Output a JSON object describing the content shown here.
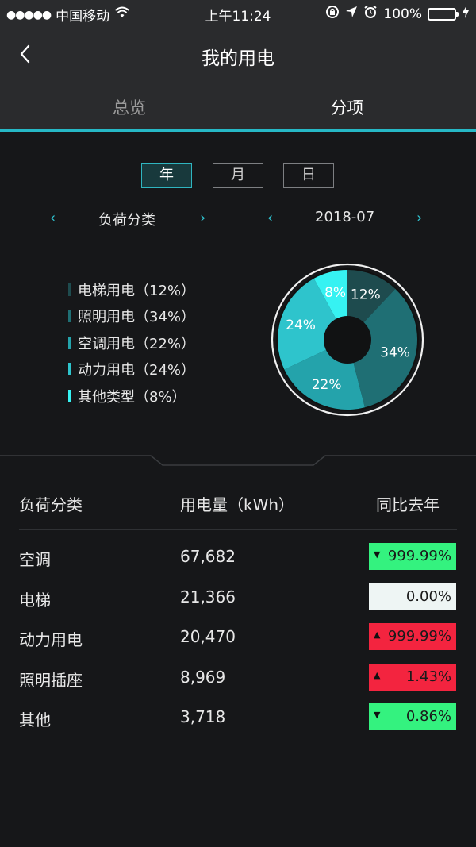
{
  "status": {
    "signal": "●●●●●",
    "carrier": "中国移动",
    "time": "上午11:24",
    "battery": "100%"
  },
  "nav": {
    "title": "我的用电"
  },
  "tabs": [
    {
      "label": "总览",
      "active": false
    },
    {
      "label": "分项",
      "active": true
    }
  ],
  "period": [
    {
      "label": "年",
      "active": true
    },
    {
      "label": "月",
      "active": false
    },
    {
      "label": "日",
      "active": false
    }
  ],
  "selectors": {
    "category": "负荷分类",
    "date": "2018-07",
    "prev": "‹",
    "next": "›"
  },
  "legend": [
    {
      "label": "电梯用电（12%）",
      "color": "#1e4b4e"
    },
    {
      "label": "照明用电（34%）",
      "color": "#1f6f74"
    },
    {
      "label": "空调用电（22%）",
      "color": "#24a3ab"
    },
    {
      "label": "动力用电（24%）",
      "color": "#2ec4cc"
    },
    {
      "label": "其他类型（8%）",
      "color": "#36f2f2"
    }
  ],
  "chart_data": {
    "type": "pie",
    "series": [
      {
        "name": "电梯用电",
        "value": 12,
        "label": "12%",
        "color": "#1e4b4e"
      },
      {
        "name": "照明用电",
        "value": 34,
        "label": "34%",
        "color": "#1f6f74"
      },
      {
        "name": "空调用电",
        "value": 22,
        "label": "22%",
        "color": "#24a3ab"
      },
      {
        "name": "动力用电",
        "value": 24,
        "label": "24%",
        "color": "#2ec4cc"
      },
      {
        "name": "其他类型",
        "value": 8,
        "label": "8%",
        "color": "#36f2f2"
      }
    ]
  },
  "table": {
    "headers": [
      "负荷分类",
      "用电量（kWh）",
      "同比去年"
    ],
    "rows": [
      {
        "name": "空调",
        "value": "67,682",
        "change": "999.99%",
        "direction": "down",
        "color": "#34f27f"
      },
      {
        "name": "电梯",
        "value": "21,366",
        "change": "0.00%",
        "direction": "none",
        "color": "#eef5f4"
      },
      {
        "name": "动力用电",
        "value": "20,470",
        "change": "999.99%",
        "direction": "up",
        "color": "#f3243f"
      },
      {
        "name": "照明插座",
        "value": "8,969",
        "change": "1.43%",
        "direction": "up",
        "color": "#f3243f"
      },
      {
        "name": "其他",
        "value": "3,718",
        "change": "0.86%",
        "direction": "down",
        "color": "#34f27f"
      }
    ]
  }
}
